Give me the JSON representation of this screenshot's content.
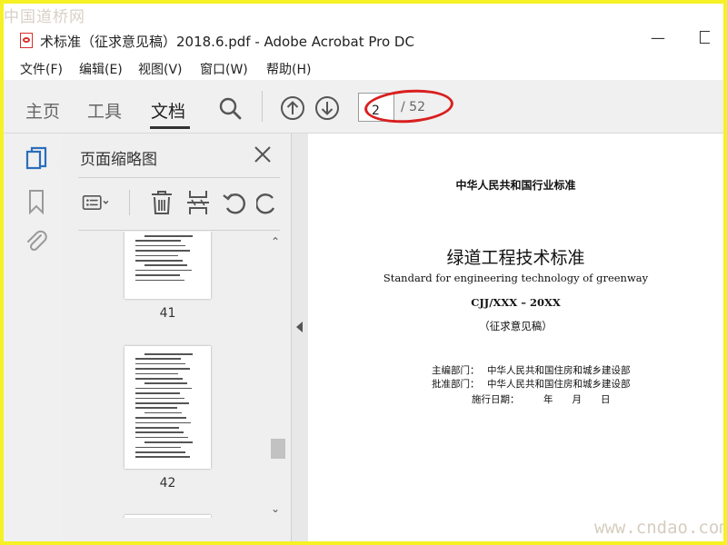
{
  "watermarks": {
    "top": "中国道桥网",
    "bottom": "www.cndao.com"
  },
  "window": {
    "title": "术标准（征求意见稿）2018.6.pdf - Adobe Acrobat Pro DC"
  },
  "menu": [
    "文件(F)",
    "编辑(E)",
    "视图(V)",
    "窗口(W)",
    "帮助(H)"
  ],
  "toolbar": {
    "tabs": [
      "主页",
      "工具",
      "文档"
    ],
    "active_tab": "文档",
    "current_page": "2",
    "total_pages": "/ 52"
  },
  "panel": {
    "title": "页面缩略图",
    "thumbnails": [
      {
        "page": "41"
      },
      {
        "page": "42"
      }
    ]
  },
  "document": {
    "header": "中华人民共和国行业标准",
    "title": "绿道工程技术标准",
    "subtitle": "Standard for engineering technology of greenway",
    "code": "CJJ/XXX – 20XX",
    "draft": "（征求意见稿）",
    "editor_label": "主编部门：",
    "editor_value": "中华人民共和国住房和城乡建设部",
    "approver_label": "批准部门：",
    "approver_value": "中华人民共和国住房和城乡建设部",
    "date_label": "施行日期：",
    "date_value": "年　　月　　日"
  },
  "colors": {
    "highlight": "#d91f1f",
    "pdf_brand": "#d6302f",
    "accent_icon": "#2a6ebb",
    "border": "#f6f124"
  },
  "icons": [
    "pdf-file-icon",
    "search-icon",
    "previous-page-icon",
    "next-page-icon",
    "page-thumbnails-icon",
    "bookmark-icon",
    "attachment-icon",
    "close-icon",
    "thumbnail-options-icon",
    "delete-page-icon",
    "insert-page-icon",
    "rotate-left-icon",
    "rotate-right-icon"
  ]
}
